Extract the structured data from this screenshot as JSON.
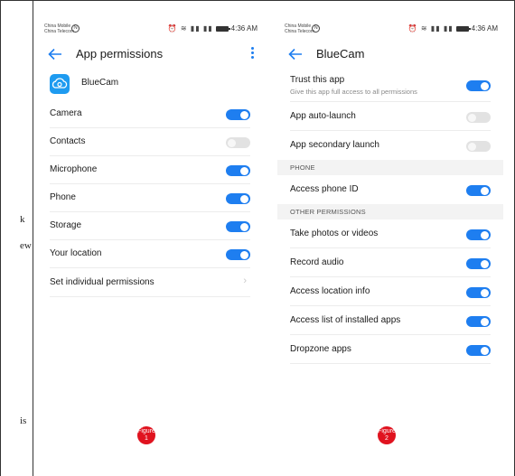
{
  "page": {
    "left_fragments": [
      "k",
      "ew",
      "is"
    ]
  },
  "status_bar": {
    "carrier_line1": "China Mobile",
    "carrier_line2": "China Telecom",
    "time": "4:36 AM",
    "icons": [
      "nfc-icon",
      "alarm-icon",
      "wifi-icon",
      "signal-icon",
      "battery-icon"
    ]
  },
  "figures": [
    {
      "label": "Figure",
      "number": "1"
    },
    {
      "label": "Figure",
      "number": "2"
    }
  ],
  "screen1": {
    "title": "App permissions",
    "app_name": "BlueCam",
    "permissions": [
      {
        "label": "Camera",
        "enabled": true
      },
      {
        "label": "Contacts",
        "enabled": false
      },
      {
        "label": "Microphone",
        "enabled": true
      },
      {
        "label": "Phone",
        "enabled": true
      },
      {
        "label": "Storage",
        "enabled": true
      },
      {
        "label": "Your location",
        "enabled": true
      }
    ],
    "set_individual": "Set individual permissions"
  },
  "screen2": {
    "title": "BlueCam",
    "trust": {
      "label": "Trust this app",
      "sublabel": "Give this app full access to all permissions",
      "enabled": true
    },
    "auto_launch": {
      "label": "App auto-launch",
      "enabled": false
    },
    "secondary_launch": {
      "label": "App secondary launch",
      "enabled": false
    },
    "section_phone": "PHONE",
    "access_phone_id": {
      "label": "Access phone ID",
      "enabled": true
    },
    "section_other": "OTHER PERMISSIONS",
    "other": [
      {
        "label": "Take photos or videos",
        "enabled": true
      },
      {
        "label": "Record audio",
        "enabled": true
      },
      {
        "label": "Access location info",
        "enabled": true
      },
      {
        "label": "Access list of installed apps",
        "enabled": true
      },
      {
        "label": "Dropzone apps",
        "enabled": true
      }
    ]
  },
  "colors": {
    "accent": "#1e7ef0",
    "toggle_off": "#e2e2e2",
    "badge": "#e0131f",
    "app_icon": "#1e9bf0"
  }
}
